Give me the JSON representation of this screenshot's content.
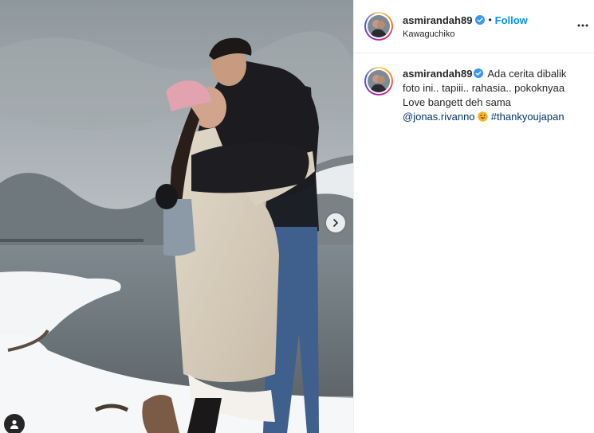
{
  "post": {
    "username": "asmirandah89",
    "follow_label": "Follow",
    "dot": "•",
    "location": "Kawaguchiko"
  },
  "caption": {
    "username": "asmirandah89",
    "text": "Ada cerita dibalik foto ini.. tapiii.. rahasia.. pokoknyaa Love bangett deh sama",
    "mention": "@jonas.rivanno",
    "hashtag": "#thankyoujapan",
    "emoji": "grinning-face-with-tongue-emoji"
  },
  "icons": {
    "verified": "verified-badge-icon",
    "more": "more-options-icon",
    "next": "chevron-right-icon",
    "tags": "user-tag-icon"
  },
  "colors": {
    "link_blue": "#0095f6",
    "verified_blue": "#3897f0",
    "mention_blue": "#00376b"
  }
}
